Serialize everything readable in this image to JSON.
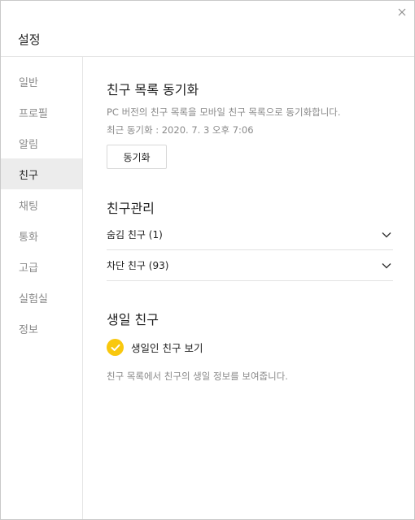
{
  "window": {
    "title": "설정",
    "close_icon": "close-icon"
  },
  "sidebar": {
    "items": [
      {
        "label": "일반"
      },
      {
        "label": "프로필"
      },
      {
        "label": "알림"
      },
      {
        "label": "친구",
        "active": true
      },
      {
        "label": "채팅"
      },
      {
        "label": "통화"
      },
      {
        "label": "고급"
      },
      {
        "label": "실험실"
      },
      {
        "label": "정보"
      }
    ]
  },
  "friend_sync": {
    "title": "친구 목록 동기화",
    "description": "PC 버전의 친구 목록을 모바일 친구 목록으로 동기화합니다.",
    "last_sync": "최근 동기화 : 2020. 7. 3 오후 7:06",
    "button_label": "동기화"
  },
  "friend_manage": {
    "title": "친구관리",
    "rows": [
      {
        "label": "숨김 친구 (1)"
      },
      {
        "label": "차단 친구 (93)"
      }
    ]
  },
  "birthday": {
    "title": "생일 친구",
    "checkbox_label": "생일인 친구 보기",
    "checked": true,
    "description": "친구 목록에서 친구의 생일 정보를 보여줍니다."
  },
  "colors": {
    "accent": "#f9c80e",
    "active_bg": "#ececec"
  }
}
